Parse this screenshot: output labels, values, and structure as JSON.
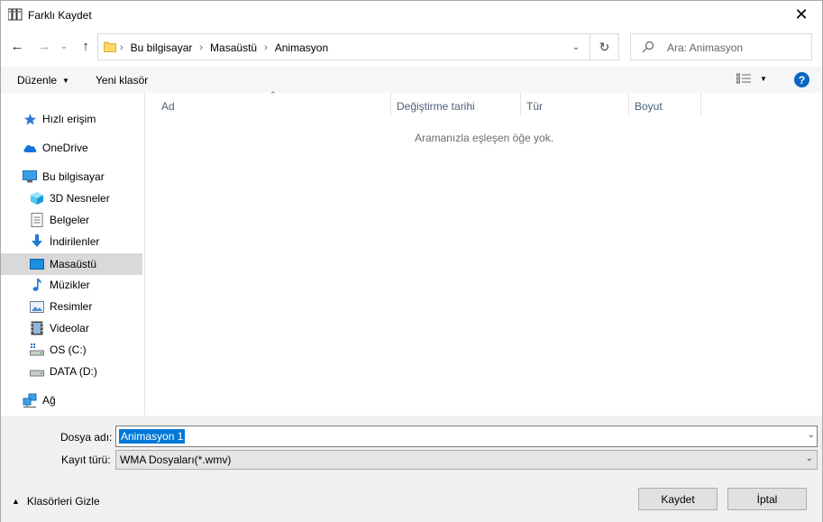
{
  "window": {
    "title": "Farklı Kaydet",
    "close_symbol": "✕"
  },
  "nav": {
    "back_symbol": "←",
    "forward_symbol": "→",
    "recent_symbol": "⌄",
    "up_symbol": "↑",
    "breadcrumbs": [
      "Bu bilgisayar",
      "Masaüstü",
      "Animasyon"
    ],
    "separator": "›",
    "dropdown_symbol": "⌄",
    "refresh_symbol": "↻",
    "search_placeholder": "Ara: Animasyon"
  },
  "toolbar": {
    "organize_label": "Düzenle",
    "new_folder_label": "Yeni klasör",
    "help_label": "?"
  },
  "sidebar": {
    "items": [
      {
        "label": "Hızlı erişim",
        "icon": "star-icon"
      },
      {
        "label": "OneDrive",
        "icon": "cloud-icon"
      },
      {
        "label": "Bu bilgisayar",
        "icon": "computer-icon"
      },
      {
        "label": "3D Nesneler",
        "icon": "cube-icon"
      },
      {
        "label": "Belgeler",
        "icon": "document-icon"
      },
      {
        "label": "İndirilenler",
        "icon": "download-icon"
      },
      {
        "label": "Masaüstü",
        "icon": "desktop-icon",
        "selected": true
      },
      {
        "label": "Müzikler",
        "icon": "music-icon"
      },
      {
        "label": "Resimler",
        "icon": "picture-icon"
      },
      {
        "label": "Videolar",
        "icon": "video-icon"
      },
      {
        "label": "OS (C:)",
        "icon": "drive-c-icon"
      },
      {
        "label": "DATA (D:)",
        "icon": "drive-d-icon"
      },
      {
        "label": "Ağ",
        "icon": "network-icon"
      }
    ]
  },
  "filelist": {
    "columns": [
      "Ad",
      "Değiştirme tarihi",
      "Tür",
      "Boyut"
    ],
    "empty_message": "Aramanızla eşleşen öğe yok."
  },
  "form": {
    "filename_label": "Dosya adı:",
    "filename_value": "Animasyon 1",
    "filetype_label": "Kayıt türü:",
    "filetype_value": "WMA Dosyaları(*.wmv)"
  },
  "footer": {
    "hide_folders_label": "Klasörleri Gizle",
    "save_label": "Kaydet",
    "cancel_label": "İptal"
  },
  "colors": {
    "accent": "#0078d7",
    "selection": "#d9d9d9",
    "help": "#0a66c2"
  }
}
